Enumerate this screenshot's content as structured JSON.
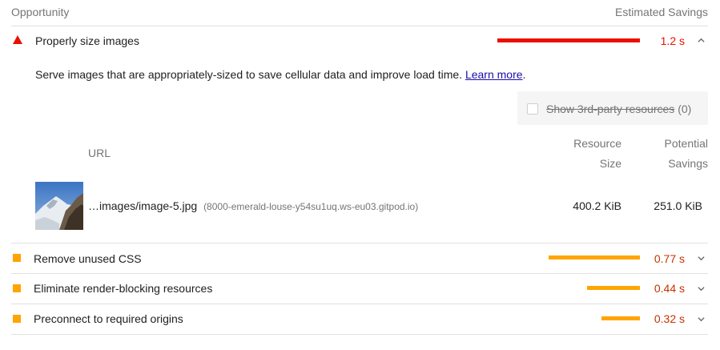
{
  "header": {
    "opportunity": "Opportunity",
    "estimated_savings": "Estimated Savings"
  },
  "audits": [
    {
      "title": "Properly size images",
      "value": "1.2 s",
      "severity": "fail",
      "color": "#eb0f00",
      "savings_fraction": 1.0,
      "expanded": true
    },
    {
      "title": "Remove unused CSS",
      "value": "0.77 s",
      "severity": "average",
      "color": "#ffa400",
      "savings_fraction": 0.64,
      "expanded": false
    },
    {
      "title": "Eliminate render-blocking resources",
      "value": "0.44 s",
      "severity": "average",
      "color": "#ffa400",
      "savings_fraction": 0.37,
      "expanded": false
    },
    {
      "title": "Preconnect to required origins",
      "value": "0.32 s",
      "severity": "average",
      "color": "#ffa400",
      "savings_fraction": 0.27,
      "expanded": false
    }
  ],
  "details": {
    "description": "Serve images that are appropriately-sized to save cellular data and improve load time. ",
    "learn_more": "Learn more",
    "period": ".",
    "third_party_label": "Show 3rd-party resources",
    "third_party_count": "(0)",
    "table": {
      "col_url": "URL",
      "col_resource_size_1": "Resource",
      "col_resource_size_2": "Size",
      "col_potential_savings_1": "Potential",
      "col_potential_savings_2": "Savings",
      "rows": [
        {
          "url": "…images/image-5.jpg",
          "host": "(8000-emerald-louse-y54su1uq.ws-eu03.gitpod.io)",
          "resource_size": "400.2 KiB",
          "potential_savings": "251.0 KiB"
        }
      ]
    }
  }
}
